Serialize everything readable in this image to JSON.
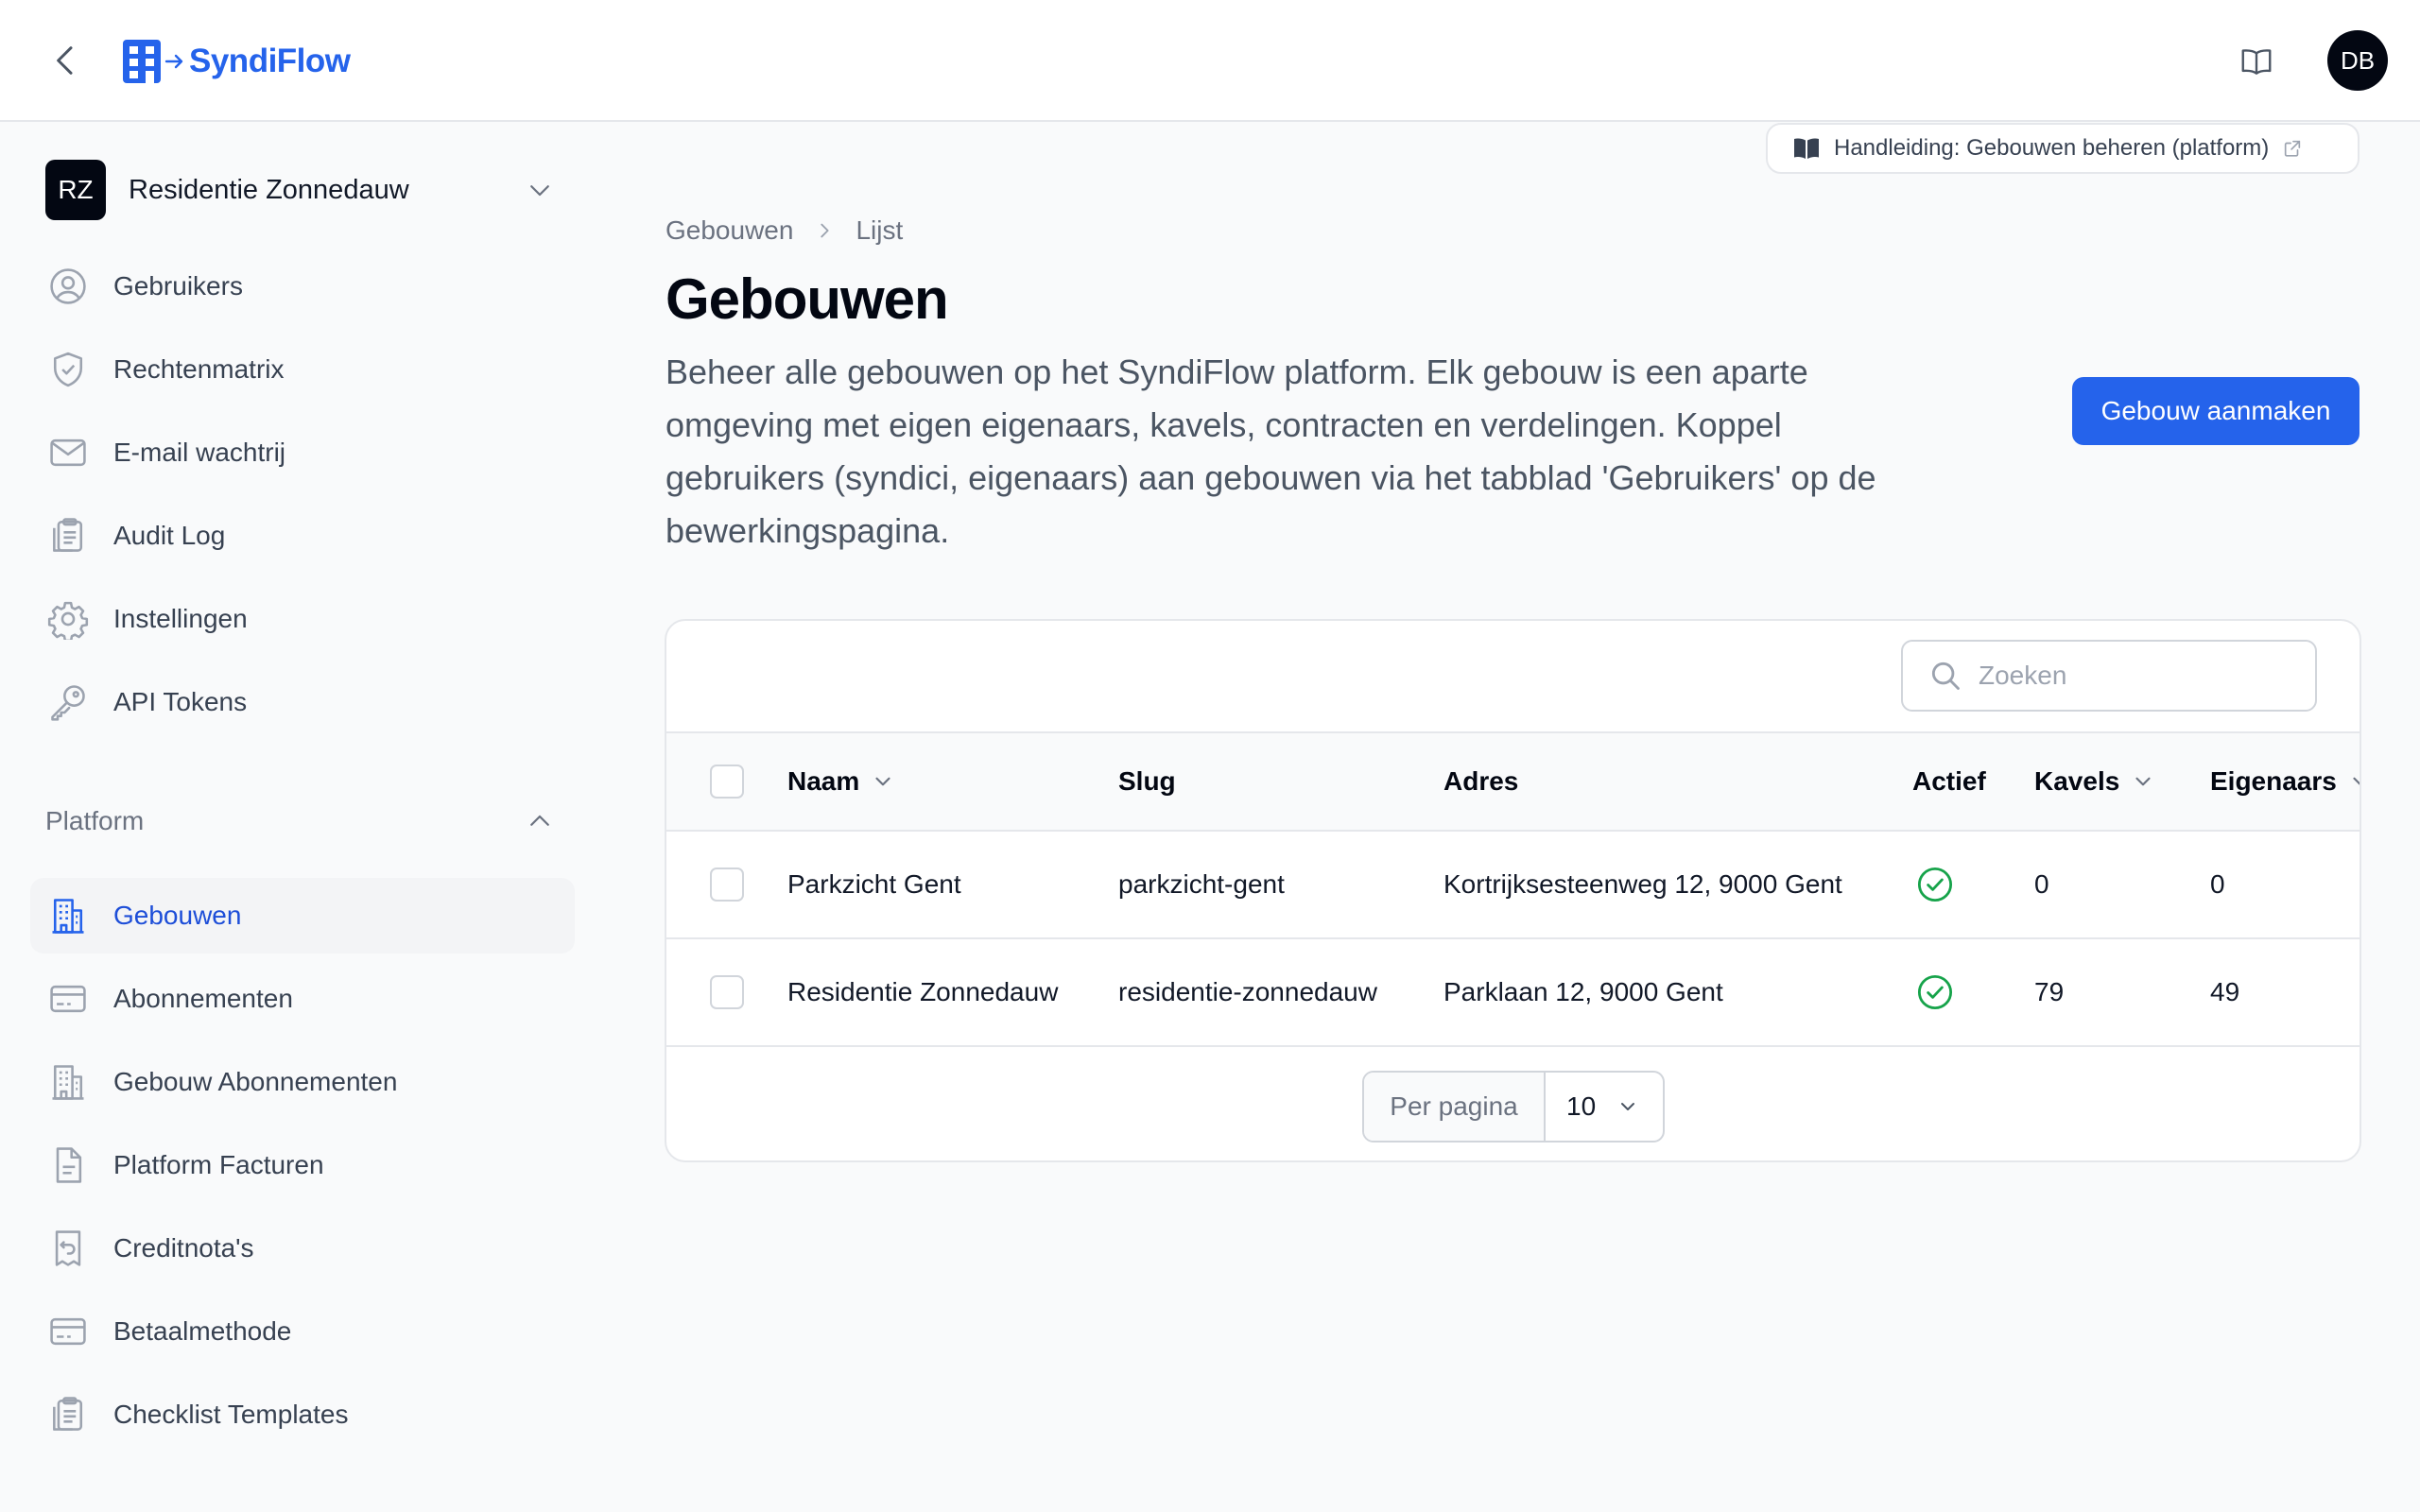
{
  "app": {
    "brand_name": "SyndiFlow",
    "accent_color": "#2563eb",
    "user_initials": "DB"
  },
  "tenant": {
    "initials": "RZ",
    "name": "Residentie Zonnedauw"
  },
  "sidebar": {
    "items": [
      {
        "label": "Gebruikers",
        "icon": "user-circle-icon"
      },
      {
        "label": "Rechtenmatrix",
        "icon": "shield-check-icon"
      },
      {
        "label": "E-mail wachtrij",
        "icon": "envelope-icon"
      },
      {
        "label": "Audit Log",
        "icon": "clipboard-icon"
      },
      {
        "label": "Instellingen",
        "icon": "gear-icon"
      },
      {
        "label": "API Tokens",
        "icon": "key-icon"
      }
    ],
    "platform_group": {
      "label": "Platform",
      "items": [
        {
          "label": "Gebouwen",
          "icon": "building-icon",
          "active": true
        },
        {
          "label": "Abonnementen",
          "icon": "credit-card-icon"
        },
        {
          "label": "Gebouw Abonnementen",
          "icon": "building-office-icon"
        },
        {
          "label": "Platform Facturen",
          "icon": "document-icon"
        },
        {
          "label": "Creditnota's",
          "icon": "receipt-refund-icon"
        },
        {
          "label": "Betaalmethode",
          "icon": "credit-card-icon"
        },
        {
          "label": "Checklist Templates",
          "icon": "clipboard-icon"
        }
      ]
    }
  },
  "main": {
    "manual_link": "Handleiding: Gebouwen beheren (platform)",
    "breadcrumb": [
      "Gebouwen",
      "Lijst"
    ],
    "title": "Gebouwen",
    "description": "Beheer alle gebouwen op het SyndiFlow platform. Elk gebouw is een aparte omgeving met eigen eigenaars, kavels, contracten en verdelingen. Koppel gebruikers (syndici, eigenaars) aan gebouwen via het tabblad 'Gebruikers' op de bewerkingspagina.",
    "create_button": "Gebouw aanmaken"
  },
  "table": {
    "search_placeholder": "Zoeken",
    "columns": [
      "Naam",
      "Slug",
      "Adres",
      "Actief",
      "Kavels",
      "Eigenaars"
    ],
    "rows": [
      {
        "naam": "Parkzicht Gent",
        "slug": "parkzicht-gent",
        "adres": "Kortrijksesteenweg 12, 9000 Gent",
        "actief": true,
        "kavels": "0",
        "eigenaars": "0"
      },
      {
        "naam": "Residentie Zonnedauw",
        "slug": "residentie-zonnedauw",
        "adres": "Parklaan 12, 9000 Gent",
        "actief": true,
        "kavels": "79",
        "eigenaars": "49"
      }
    ],
    "pagination": {
      "label": "Per pagina",
      "value": "10"
    }
  }
}
